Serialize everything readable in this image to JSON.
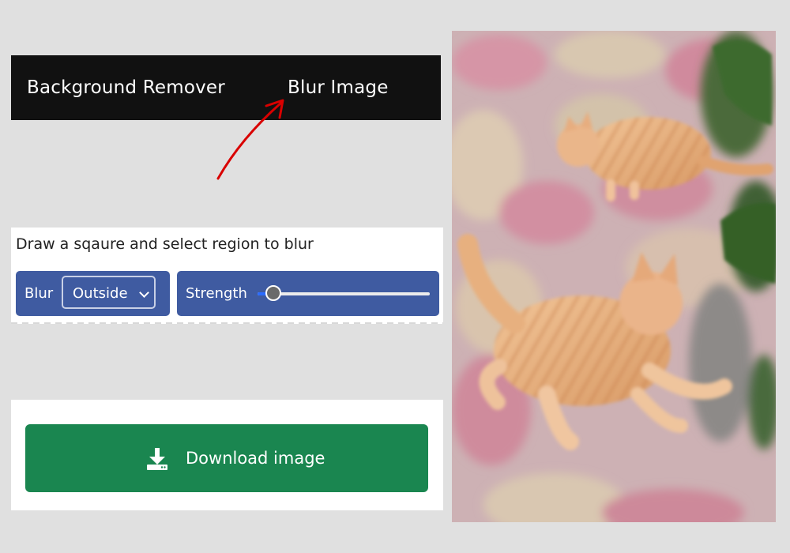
{
  "nav": {
    "items": [
      {
        "label": "Background Remover"
      },
      {
        "label": "Blur Image"
      }
    ]
  },
  "blur_panel": {
    "instruction": "Draw a sqaure and select region to blur",
    "blur_label": "Blur",
    "blur_mode": {
      "selected": "Outside"
    },
    "strength_label": "Strength",
    "strength_value": 0.09
  },
  "download": {
    "label": "Download image",
    "color": "#1a8650"
  },
  "colors": {
    "nav_background": "#111111",
    "control_background": "#3f5ba1",
    "annotation_arrow": "#d90000",
    "page_background": "#e0e0e0"
  },
  "preview": {
    "description_icon": "cat-photo-icon"
  }
}
